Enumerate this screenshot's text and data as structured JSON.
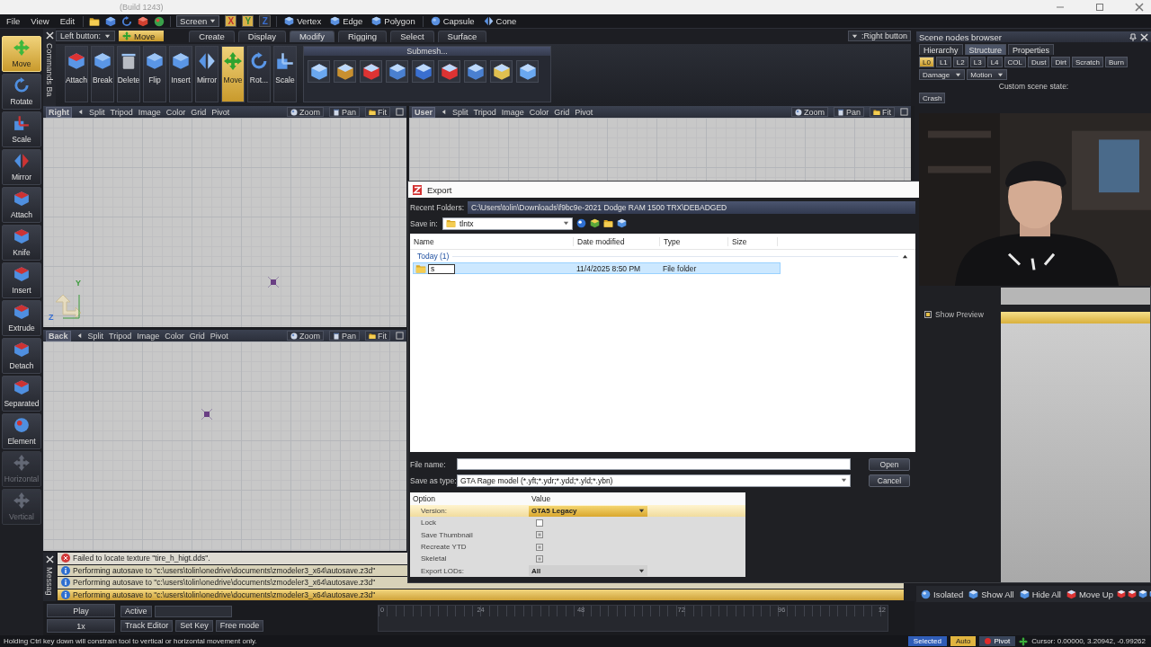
{
  "window": {
    "title": "(Build 1243)"
  },
  "menu": [
    "File",
    "View",
    "Edit"
  ],
  "toolbar": {
    "screen_dropdown": "Screen",
    "axes": [
      {
        "label": "X",
        "selected": true
      },
      {
        "label": "Y",
        "selected": true
      },
      {
        "label": "Z",
        "selected": false
      }
    ],
    "selection_modes": [
      "Vertex",
      "Edge",
      "Polygon"
    ],
    "primitives": [
      "Capsule",
      "Cone"
    ]
  },
  "commands_panel": {
    "title": "Commands Ba",
    "items": [
      {
        "label": "Move",
        "selected": true,
        "disabled": false
      },
      {
        "label": "Rotate",
        "selected": false,
        "disabled": false
      },
      {
        "label": "Scale",
        "selected": false,
        "disabled": false
      },
      {
        "label": "Mirror",
        "selected": false,
        "disabled": false
      },
      {
        "label": "Attach",
        "selected": false,
        "disabled": false
      },
      {
        "label": "Knife",
        "selected": false,
        "disabled": false
      },
      {
        "label": "Insert",
        "selected": false,
        "disabled": false
      },
      {
        "label": "Extrude",
        "selected": false,
        "disabled": false
      },
      {
        "label": "Detach",
        "selected": false,
        "disabled": false
      },
      {
        "label": "Separated",
        "selected": false,
        "disabled": false
      },
      {
        "label": "Element",
        "selected": false,
        "disabled": false
      },
      {
        "label": "Horizontal",
        "selected": false,
        "disabled": true
      },
      {
        "label": "Vertical",
        "selected": false,
        "disabled": true
      }
    ]
  },
  "ribbon": {
    "left_button_label": "Left button:",
    "left_button_value": "Move",
    "right_button": ":Right button",
    "tabs": [
      {
        "label": "Create",
        "selected": false
      },
      {
        "label": "Display",
        "selected": false
      },
      {
        "label": "Modify",
        "selected": true
      },
      {
        "label": "Rigging",
        "selected": false
      },
      {
        "label": "Select",
        "selected": false
      },
      {
        "label": "Surface",
        "selected": false
      }
    ],
    "tools": [
      {
        "label": "Attach",
        "selected": false
      },
      {
        "label": "Break",
        "selected": false
      },
      {
        "label": "Delete",
        "selected": false
      },
      {
        "label": "Flip",
        "selected": false
      },
      {
        "label": "Insert",
        "selected": false
      },
      {
        "label": "Mirror",
        "selected": false
      },
      {
        "label": "Move",
        "selected": true
      },
      {
        "label": "Rot...",
        "selected": false
      },
      {
        "label": "Scale",
        "selected": false
      }
    ],
    "submesh_title": "Submesh..."
  },
  "viewports": [
    {
      "name": "Right",
      "menu": [
        "Split",
        "Tripod",
        "Image",
        "Color",
        "Grid",
        "Pivot"
      ],
      "tools": [
        "Zoom",
        "Pan",
        "Fit"
      ],
      "axis_labels": [
        "Y",
        "Z"
      ]
    },
    {
      "name": "User",
      "menu": [
        "Split",
        "Tripod",
        "Image",
        "Color",
        "Grid",
        "Pivot"
      ],
      "tools": [
        "Zoom",
        "Pan",
        "Fit"
      ]
    },
    {
      "name": "Back",
      "menu": [
        "Split",
        "Tripod",
        "Image",
        "Color",
        "Grid",
        "Pivot"
      ],
      "tools": [
        "Zoom",
        "Pan",
        "Fit"
      ]
    }
  ],
  "messages_panel": {
    "title": "Messag",
    "items": [
      {
        "kind": "error",
        "text": "Failed to locate texture \"tire_h_higt.dds\".",
        "selected": false
      },
      {
        "kind": "info",
        "text": "Performing autosave to \"c:\\users\\tolin\\onedrive\\documents\\zmodeler3_x64\\autosave.z3d\"",
        "selected": false
      },
      {
        "kind": "info",
        "text": "Performing autosave to \"c:\\users\\tolin\\onedrive\\documents\\zmodeler3_x64\\autosave.z3d\"",
        "selected": false
      },
      {
        "kind": "info",
        "text": "Performing autosave to \"c:\\users\\tolin\\onedrive\\documents\\zmodeler3_x64\\autosave.z3d\"",
        "selected": true
      }
    ]
  },
  "timeline": {
    "play": "Play",
    "speed": "1x",
    "active": "Active",
    "buttons": [
      "Track Editor",
      "Set Key",
      "Free mode"
    ],
    "ticks": [
      "0",
      "24",
      "48",
      "72",
      "96",
      "12"
    ]
  },
  "scene_browser": {
    "title": "Scene nodes browser",
    "tabs": [
      {
        "label": "Hierarchy",
        "selected": false
      },
      {
        "label": "Structure",
        "selected": true
      },
      {
        "label": "Properties",
        "selected": false
      }
    ],
    "levels": [
      {
        "label": "L0",
        "selected": true
      },
      {
        "label": "L1",
        "selected": false
      },
      {
        "label": "L2",
        "selected": false
      },
      {
        "label": "L3",
        "selected": false
      },
      {
        "label": "L4",
        "selected": false
      },
      {
        "label": "COL",
        "selected": false
      },
      {
        "label": "Dust",
        "selected": false
      },
      {
        "label": "Dirt",
        "selected": false
      },
      {
        "label": "Scratch",
        "selected": false
      },
      {
        "label": "Burn",
        "selected": false
      }
    ],
    "dropdowns": [
      "Damage",
      "Motion"
    ],
    "custom_state_label": "Custom scene state:",
    "state_buttons": [
      "Crash"
    ],
    "bottom_tools": [
      "Isolated",
      "Show All",
      "Hide All",
      "Move Up"
    ]
  },
  "export_dialog": {
    "title": "Export",
    "recent_label": "Recent Folders:",
    "recent_path": "C:\\Users\\tolin\\Downloads\\f9bc9e-2021 Dodge RAM 1500 TRX\\DEBADGED",
    "save_in_label": "Save in:",
    "save_in": "tlntx",
    "columns": [
      "Name",
      "Date modified",
      "Type",
      "Size"
    ],
    "group": "Today (1)",
    "rows": [
      {
        "name": "s",
        "date": "11/4/2025 8:50 PM",
        "type": "File folder",
        "selected": true
      }
    ],
    "file_name_label": "File name:",
    "save_type_label": "Save as type:",
    "save_type": "GTA Rage model (*.yft;*.ydr;*.ydd;*.yld;*.ybn)",
    "buttons": [
      "Open",
      "Cancel"
    ],
    "option_columns": [
      "Option",
      "Value"
    ],
    "options": [
      {
        "kind": "dropdown",
        "label": "Version:",
        "value": "GTA5 Legacy",
        "selected": true
      },
      {
        "kind": "checkbox",
        "label": "Lock",
        "checked": false,
        "selected": false
      },
      {
        "kind": "checkbox",
        "label": "Save Thumbnail",
        "checked": true,
        "selected": false
      },
      {
        "kind": "checkbox",
        "label": "Recreate YTD",
        "checked": true,
        "selected": false
      },
      {
        "kind": "checkbox",
        "label": "Skeletal",
        "checked": true,
        "selected": false
      },
      {
        "kind": "dropdown",
        "label": "Export LODs:",
        "value": "All",
        "selected": false
      }
    ],
    "show_preview": {
      "label": "Show Preview",
      "checked": true
    }
  },
  "status_bar": {
    "hint": "Holding Ctrl key down will constrain tool to vertical or horizontal movement only.",
    "badges": [
      {
        "kind": "selected",
        "label": "Selected"
      },
      {
        "kind": "auto",
        "label": "Auto"
      },
      {
        "kind": "pivot",
        "label": "Pivot"
      }
    ],
    "cursor": "Cursor: 0.00000, 3.20942, -0.99262"
  }
}
